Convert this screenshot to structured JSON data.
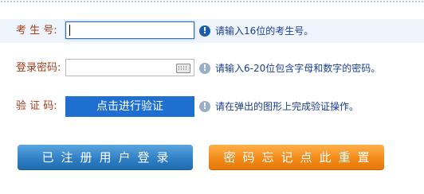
{
  "form": {
    "exam_number": {
      "label": "考 生 号:",
      "value": "",
      "hint": "请输入16位的考生号。",
      "info_icon": "info-icon"
    },
    "password": {
      "label": "登录密码:",
      "value": "",
      "hint": "请输入6-20位包含字母和数字的密码。",
      "trailing_icon": "keyboard-icon",
      "info_icon": "info-icon"
    },
    "verification": {
      "label": "验 证 码:",
      "button_label": "点击进行验证",
      "hint": "请在弹出的图形上完成验证操作。",
      "info_icon": "info-icon"
    }
  },
  "actions": {
    "login_label": "已注册用户登录",
    "reset_label": "密码忘记点此重置"
  },
  "colors": {
    "label_text": "#a63b1a",
    "hint_text": "#1a3d8f",
    "verify_button": "#1e6fd0",
    "login_button": "#2f7fc4",
    "reset_button": "#f28a18",
    "highlight_row": "#eef4fb"
  }
}
